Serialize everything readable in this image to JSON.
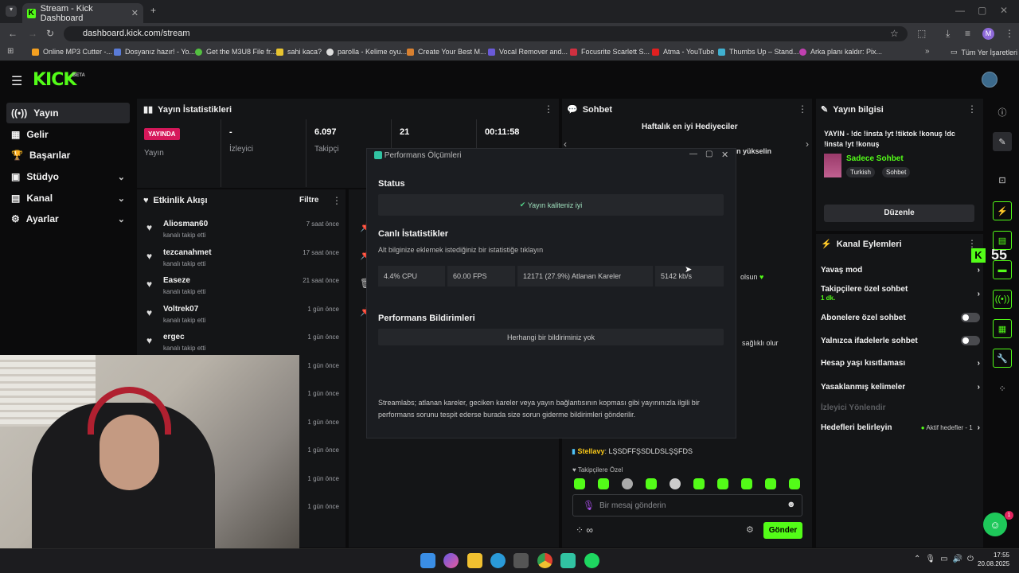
{
  "browser": {
    "tab_title": "Stream - Kick Dashboard",
    "url": "dashboard.kick.com/stream",
    "profile_initial": "M",
    "bookmarks": [
      "Online MP3 Cutter -...",
      "Dosyanız hazır! - Yo...",
      "Get the M3U8 File fr...",
      "sahi kaca?",
      "parolla - Kelime oyu...",
      "Create Your Best M...",
      "Vocal Remover and...",
      "Focusrite Scarlett S...",
      "Atma - YouTube",
      "Thumbs Up – Stand...",
      "Arka planı kaldır: Pix..."
    ],
    "all_bookmarks": "Tüm Yer İşaretleri"
  },
  "app": {
    "logo": "KICK",
    "logo_badge": "BETA"
  },
  "sidebar": {
    "items": [
      {
        "label": "Yayın",
        "icon": "stream-icon"
      },
      {
        "label": "Gelir",
        "icon": "revenue-icon"
      },
      {
        "label": "Başarılar",
        "icon": "trophy-icon"
      },
      {
        "label": "Stüdyo",
        "icon": "studio-icon"
      },
      {
        "label": "Kanal",
        "icon": "channel-icon"
      },
      {
        "label": "Ayarlar",
        "icon": "settings-icon"
      }
    ]
  },
  "stats_panel": {
    "title": "Yayın İstatistikleri",
    "live_badge": "YAYINDA",
    "live_label": "Yayın",
    "viewers_value": "-",
    "viewers_label": "İzleyici",
    "followers_value": "6.097",
    "followers_label": "Takipçi",
    "col3_value": "21",
    "duration_value": "00:11:58"
  },
  "activity": {
    "title": "Etkinlik Akışı",
    "filter": "Filtre",
    "events": [
      {
        "name": "Aliosman60",
        "sub": "kanalı takip etti",
        "time": "7 saat önce"
      },
      {
        "name": "tezcanahmet",
        "sub": "kanalı takip etti",
        "time": "17 saat önce"
      },
      {
        "name": "Easeze",
        "sub": "kanalı takip etti",
        "time": "21 saat önce"
      },
      {
        "name": "Voltrek07",
        "sub": "kanalı takip etti",
        "time": "1 gün önce"
      },
      {
        "name": "ergec",
        "sub": "kanalı takip etti",
        "time": "1 gün önce"
      }
    ],
    "extra_times": [
      "1 gün önce",
      "1 gün önce",
      "1 gün önce",
      "1 gün önce",
      "1 gün önce",
      "1 gün önce"
    ]
  },
  "chat": {
    "title": "Sohbet",
    "gifters_title": "Haftalık en iyi Hediyeciler",
    "gifters_tail": "n yükselin",
    "msg1_tail": "olsun",
    "msg2_tail": "sağlıklı olur",
    "last_user": "Stellavy",
    "last_msg": "LŞSDFFŞSDLDSLŞŞFDS",
    "followers_only": "Takipçilere Özel",
    "placeholder": "Bir mesaj gönderin",
    "send": "Gönder"
  },
  "modal": {
    "title": "Performans Ölçümleri",
    "status_h": "Status",
    "status_msg": "Yayın kaliteniz iyi",
    "live_h": "Canlı İstatistikler",
    "live_sub": "Alt bilginize eklemek istediğiniz bir istatistiğe tıklayın",
    "cells": [
      "4.4% CPU",
      "60.00 FPS",
      "12171 (27.9%) Atlanan Kareler",
      "5142 kb/s"
    ],
    "notif_h": "Performans Bildirimleri",
    "notif_msg": "Herhangi bir bildiriminiz yok",
    "footer": "Streamlabs; atlanan kareler, geciken kareler veya yayın bağlantısının kopması gibi yayınınızla ilgili bir performans sorunu tespit ederse burada size sorun giderme bildirimleri gönderilir."
  },
  "stream_info": {
    "title": "Yayın bilgisi",
    "text": "YAYIN - !dc !insta !yt !tiktok !konuş !dc !insta !yt !konuş",
    "category": "Sadece Sohbet",
    "tags": [
      "Turkish",
      "Sohbet"
    ],
    "edit": "Düzenle"
  },
  "channel_actions": {
    "title": "Kanal Eylemleri",
    "slow": "Yavaş mod",
    "followers_chat": "Takipçilere özel sohbet",
    "followers_chat_sub": "1 dk.",
    "subs_chat": "Abonelere özel sohbet",
    "emote_chat": "Yalnızca ifadelerle sohbet",
    "age": "Hesap yaşı kısıtlaması",
    "banned": "Yasaklanmış kelimeler",
    "redirect": "İzleyici Yönlendir",
    "goals": "Hedefleri belirleyin",
    "goals_badge": "Aktif hedefler - 1"
  },
  "overlay_count": "55",
  "notif_count": "1",
  "clock": {
    "time": "17:55",
    "date": "20.08.2025"
  }
}
